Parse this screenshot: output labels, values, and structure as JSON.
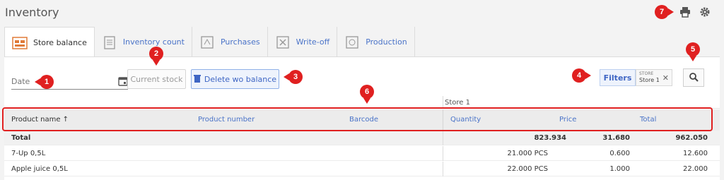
{
  "app": {
    "title": "Inventory"
  },
  "icons": {
    "print": "printer-icon",
    "settings": "gear-icon",
    "search": "search-icon",
    "calendar": "calendar-icon",
    "delete": "trash-icon"
  },
  "tabs": [
    {
      "label": "Store balance",
      "active": true
    },
    {
      "label": "Inventory count"
    },
    {
      "label": "Purchases"
    },
    {
      "label": "Write-off"
    },
    {
      "label": "Production"
    }
  ],
  "toolbar": {
    "date_placeholder": "Date",
    "current_stock": "Current stock",
    "delete_wo_balance": "Delete wo balance",
    "filters": "Filters",
    "filter_chip": {
      "label": "STORE",
      "value": "Store 1"
    }
  },
  "table": {
    "group_label": "Store 1",
    "columns": {
      "product_name": "Product name ↑",
      "product_number": "Product number",
      "barcode": "Barcode",
      "quantity": "Quantity",
      "price": "Price",
      "total": "Total"
    },
    "total_row": {
      "label": "Total",
      "quantity": "823.934",
      "price": "31.680",
      "total": "962.050"
    },
    "rows": [
      {
        "name": "7-Up 0,5L",
        "quantity": "21.000 PCS",
        "price": "0.600",
        "total": "12.600"
      },
      {
        "name": "Apple juice 0,5L",
        "quantity": "22.000 PCS",
        "price": "1.000",
        "total": "22.000"
      }
    ]
  },
  "annotations": [
    "1",
    "2",
    "3",
    "4",
    "5",
    "6",
    "7"
  ],
  "colors": {
    "accent": "#4a73c8",
    "annotation": "#e02020"
  }
}
